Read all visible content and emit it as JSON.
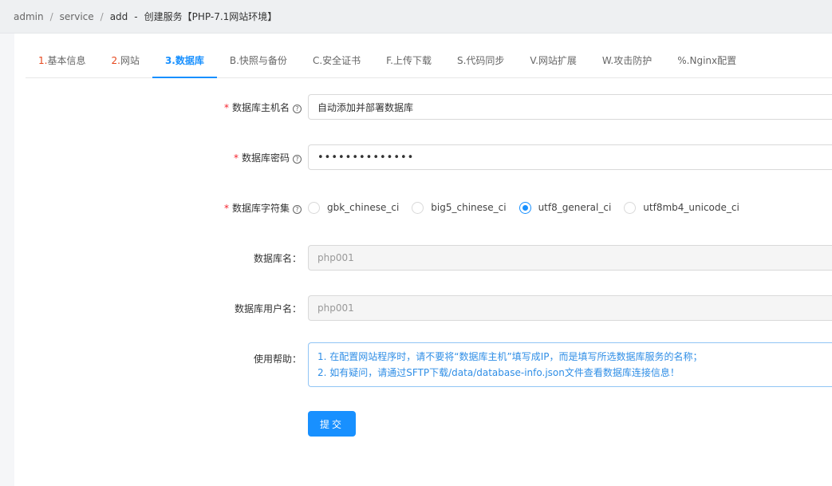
{
  "breadcrumb": {
    "items": [
      "admin",
      "service",
      "add"
    ],
    "dash": "-",
    "title": "创建服务【PHP-7.1网站环境】"
  },
  "tabs": [
    {
      "prefix": "1.",
      "label": "基本信息"
    },
    {
      "prefix": "2.",
      "label": "网站"
    },
    {
      "prefix": "3.",
      "label": "数据库"
    },
    {
      "prefix": "B.",
      "label": "快照与备份"
    },
    {
      "prefix": "C.",
      "label": "安全证书"
    },
    {
      "prefix": "F.",
      "label": "上传下载"
    },
    {
      "prefix": "S.",
      "label": "代码同步"
    },
    {
      "prefix": "V.",
      "label": "网站扩展"
    },
    {
      "prefix": "W.",
      "label": "攻击防护"
    },
    {
      "prefix": "%.",
      "label": "Nginx配置"
    }
  ],
  "form": {
    "host": {
      "label": "数据库主机名",
      "value": "自动添加并部署数据库"
    },
    "password": {
      "label": "数据库密码",
      "value": "••••••••••••••"
    },
    "charset": {
      "label": "数据库字符集",
      "options": [
        "gbk_chinese_ci",
        "big5_chinese_ci",
        "utf8_general_ci",
        "utf8mb4_unicode_ci"
      ],
      "selected": "utf8_general_ci"
    },
    "dbname": {
      "label": "数据库名：",
      "value": "php001"
    },
    "dbuser": {
      "label": "数据库用户名：",
      "value": "php001"
    },
    "helptext": {
      "label": "使用帮助：",
      "lines": [
        "1. 在配置网站程序时，请不要将“数据库主机”填写成IP，而是填写所选数据库服务的名称；",
        "2. 如有疑问，请通过SFTP下载/data/database-info.json文件查看数据库连接信息！"
      ]
    },
    "submit_label": "提交"
  },
  "colors": {
    "accent": "#1890ff",
    "required": "#f5222d",
    "tab_number": "#e6471d"
  }
}
